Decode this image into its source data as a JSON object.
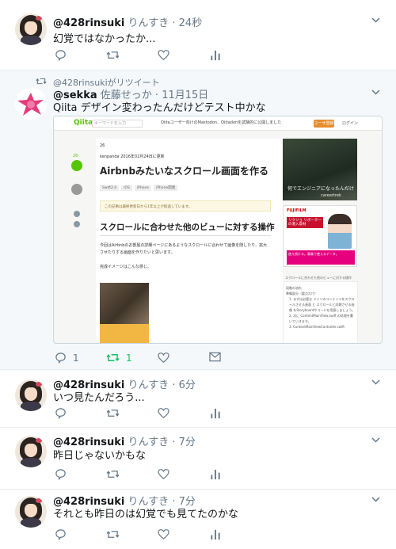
{
  "tweets": [
    {
      "handle": "@428rinsuki",
      "display": "りんすき",
      "time": "24秒",
      "text": "幻覚ではなかったか..."
    },
    {
      "retweeted_by": "@428rinsukiがリツイート",
      "handle": "@sekka",
      "display": "佐藤せっか",
      "time": "11月15日",
      "text": "Qiita デザイン変わったんだけどテスト中かな",
      "reply_count": "1",
      "retweet_count": "1"
    },
    {
      "handle": "@428rinsuki",
      "display": "りんすき",
      "time": "6分",
      "text": "いつ見たんだろう..."
    },
    {
      "handle": "@428rinsuki",
      "display": "りんすき",
      "time": "7分",
      "text": "昨日じゃないかもな"
    },
    {
      "handle": "@428rinsuki",
      "display": "りんすき",
      "time": "7分",
      "text": "それとも昨日のは幻覚でも見てたのかな"
    }
  ],
  "separator": " · ",
  "embed": {
    "logo": "Qiita",
    "search_placeholder": "キーワードを入力",
    "notice": "Qiitaユーザー向けのMastodon、Qiitadonを試験的に公開しました",
    "register": "ユーザ登録",
    "login": "ログイン",
    "like_count": "26",
    "icons_row": "26",
    "author": "kenpanda  2016年02月24日に更新",
    "title": "Airbnbみたいなスクロール画面を作る",
    "tags": [
      "Swift2.0",
      "iOS",
      "iPhone",
      "iPhone開発"
    ],
    "warning": "この記事は最終更新日から1年以上が経過しています。",
    "h2": "スクロールに合わせた他のビューに対する操作",
    "p1": "今回はAirbnbのお部屋の詳細ページにあるようなスクロールに合わせて画像を隠したり、拡大させたりする画面を作りたいと思います。",
    "p2": "完成イメージはこんな感じ。",
    "ad1_text": "何でエンジニアになったんだけ",
    "ad1_brand": "careertrek",
    "ad2_brand": "FUJIFILM",
    "ad2_red": "リクジョ リポーターの潜入取材",
    "ad2_pink": "使え続ける。事業で使えるデータ。",
    "toc_title": "スクロールに合わせた他のビューに対する操作",
    "toc_items": [
      "段階の流れ",
      "準備部分（要点だけ）",
      "1. まずは必要な メインのコンテンツをスクロールさせる画面 と スクロールと同期させる画像 をStoryboardやコードを用意しましょう。",
      "2. 次に ContentMainView.swift の処理を書いていきます。",
      "3. ContentMainViewController.swift"
    ]
  }
}
